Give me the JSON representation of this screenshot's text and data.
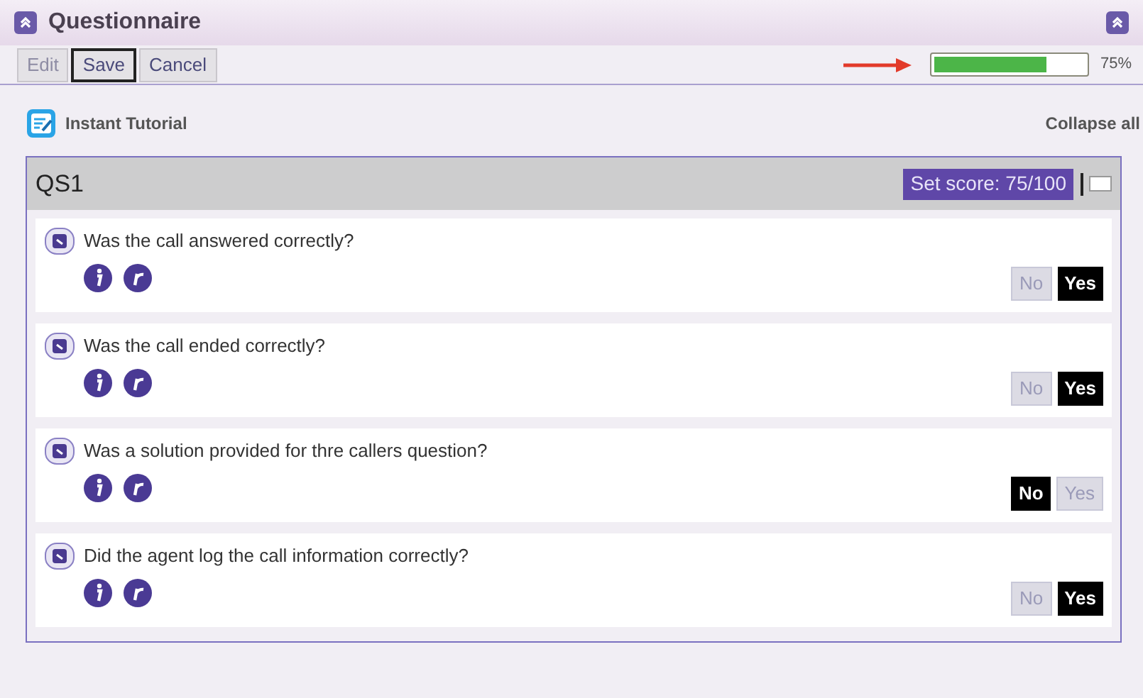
{
  "window": {
    "title": "Questionnaire"
  },
  "toolbar": {
    "buttons": [
      {
        "label": "Edit",
        "disabled": true,
        "focused": false
      },
      {
        "label": "Save",
        "disabled": false,
        "focused": true
      },
      {
        "label": "Cancel",
        "disabled": false,
        "focused": false
      }
    ],
    "progress": {
      "level": 0.75,
      "reading": "75%"
    }
  },
  "tutorial": {
    "label": "Instant Tutorial"
  },
  "collapse_all": "Collapse all",
  "section": {
    "title": "QS1",
    "score": "Set score: 75/100",
    "comment_box": {
      "checked": false
    },
    "questions": [
      {
        "text": "Was the call answered correctly?",
        "options": [
          {
            "label": "No",
            "selected": false
          },
          {
            "label": "Yes",
            "selected": true
          }
        ]
      },
      {
        "text": "Was the call ended correctly?",
        "options": [
          {
            "label": "No",
            "selected": false
          },
          {
            "label": "Yes",
            "selected": true
          }
        ]
      },
      {
        "text": "Was a solution provided for thre callers question?",
        "options": [
          {
            "label": "No",
            "selected": true
          },
          {
            "label": "Yes",
            "selected": false
          }
        ]
      },
      {
        "text": "Did the agent log the call information correctly?",
        "options": [
          {
            "label": "No",
            "selected": false
          },
          {
            "label": "Yes",
            "selected": true
          }
        ]
      }
    ]
  }
}
